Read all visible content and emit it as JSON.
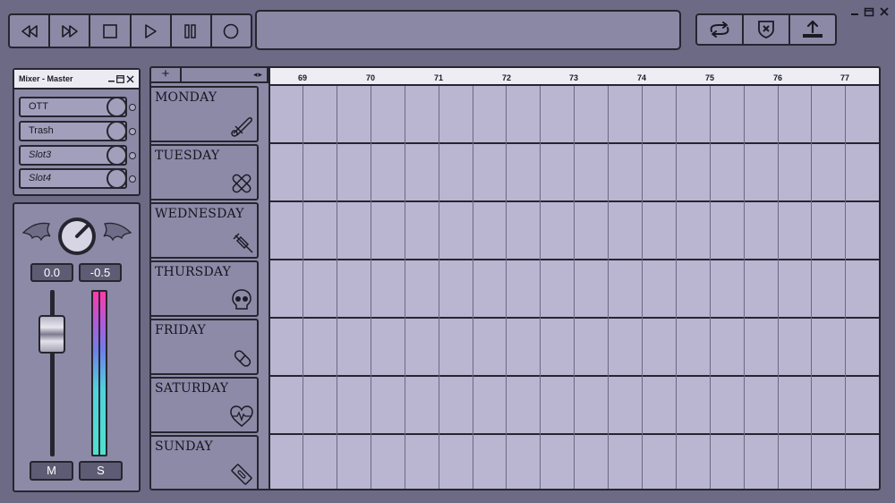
{
  "window": {
    "controls": [
      "minimize",
      "restore",
      "close"
    ]
  },
  "transport": {
    "buttons": [
      {
        "name": "rewind",
        "icon": "rewind-icon"
      },
      {
        "name": "fast-forward",
        "icon": "fast-forward-icon"
      },
      {
        "name": "stop",
        "icon": "stop-icon"
      },
      {
        "name": "play",
        "icon": "play-icon"
      },
      {
        "name": "pause",
        "icon": "pause-icon"
      },
      {
        "name": "record",
        "icon": "record-icon"
      }
    ]
  },
  "display": {
    "text": ""
  },
  "tools": {
    "buttons": [
      {
        "name": "loop",
        "icon": "loop-icon"
      },
      {
        "name": "cancel",
        "icon": "shield-x-icon"
      },
      {
        "name": "export",
        "icon": "upload-tray-icon"
      }
    ]
  },
  "mixer": {
    "title": "Mixer - Master",
    "slots": [
      {
        "label": "OTT",
        "empty": false
      },
      {
        "label": "Trash",
        "empty": false
      },
      {
        "label": "Slot3",
        "empty": true
      },
      {
        "label": "Slot4",
        "empty": true
      }
    ],
    "pan_value": "0.0",
    "volume_value": "-0.5",
    "mute_label": "M",
    "solo_label": "S"
  },
  "playlist": {
    "add_label": "+",
    "scroll_label": "◂▸",
    "ruler_ticks": [
      "69",
      "70",
      "71",
      "72",
      "73",
      "74",
      "75",
      "76",
      "77"
    ],
    "tracks": [
      {
        "name": "MONDAY",
        "icon": "safety-pin-icon"
      },
      {
        "name": "TUESDAY",
        "icon": "bandage-icon"
      },
      {
        "name": "WEDNESDAY",
        "icon": "syringe-icon"
      },
      {
        "name": "THURSDAY",
        "icon": "skull-icon"
      },
      {
        "name": "FRIDAY",
        "icon": "pill-icon"
      },
      {
        "name": "SATURDAY",
        "icon": "heartbeat-icon"
      },
      {
        "name": "SUNDAY",
        "icon": "razor-blade-icon"
      }
    ]
  },
  "colors": {
    "background": "#6d6a86",
    "panel": "#8d8aa7",
    "grid": "#bab6d1",
    "meter_top": "#ff3aa8",
    "meter_bottom": "#4fe1cf"
  }
}
